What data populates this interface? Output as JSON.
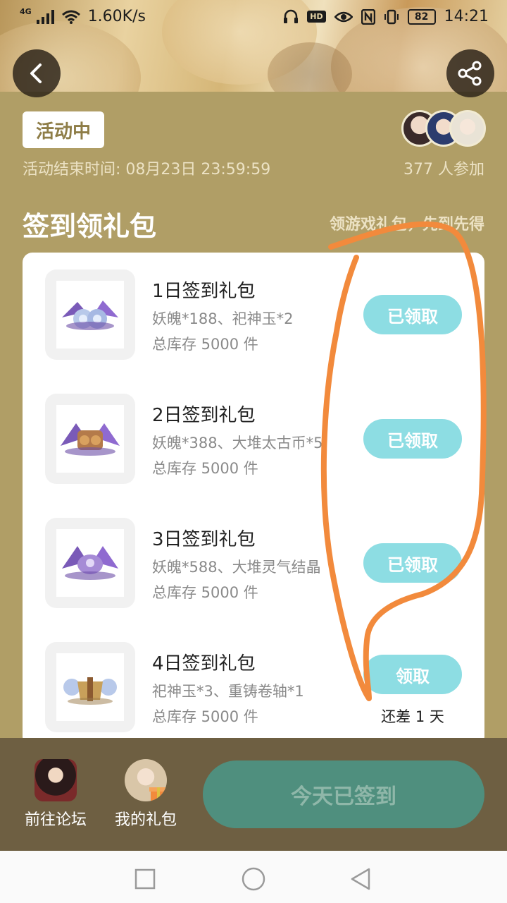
{
  "status_bar": {
    "network": "4G",
    "speed": "1.60K/s",
    "hd": "HD",
    "battery": "82",
    "time": "14:21"
  },
  "event": {
    "status": "活动中",
    "end_time": "活动结束时间: 08月23日 23:59:59",
    "participants": "377 人参加"
  },
  "section": {
    "title": "签到领礼包",
    "subtitle": "领游戏礼包，先到先得"
  },
  "gifts": [
    {
      "name": "1日签到礼包",
      "content": "妖魄*188、祀神玉*2",
      "stock": "总库存 5000 件",
      "button": "已领取",
      "note": ""
    },
    {
      "name": "2日签到礼包",
      "content": "妖魄*388、大堆太古币*5",
      "stock": "总库存 5000 件",
      "button": "已领取",
      "note": ""
    },
    {
      "name": "3日签到礼包",
      "content": "妖魄*588、大堆灵气结晶",
      "stock": "总库存 5000 件",
      "button": "已领取",
      "note": ""
    },
    {
      "name": "4日签到礼包",
      "content": "祀神玉*3、重铸卷轴*1",
      "stock": "总库存 5000 件",
      "button": "领取",
      "note": "还差 1 天"
    }
  ],
  "bottom_bar": {
    "forum_label": "前往论坛",
    "my_gifts_label": "我的礼包",
    "sign_button": "今天已签到"
  },
  "colors": {
    "background": "#b09e66",
    "claim_button": "#8ddde3",
    "sign_button": "#4f8f7e",
    "annotation": "#f28a3c"
  },
  "icons": [
    "back-arrow-icon",
    "share-icon",
    "square-nav-icon",
    "circle-nav-icon",
    "triangle-back-nav-icon"
  ]
}
